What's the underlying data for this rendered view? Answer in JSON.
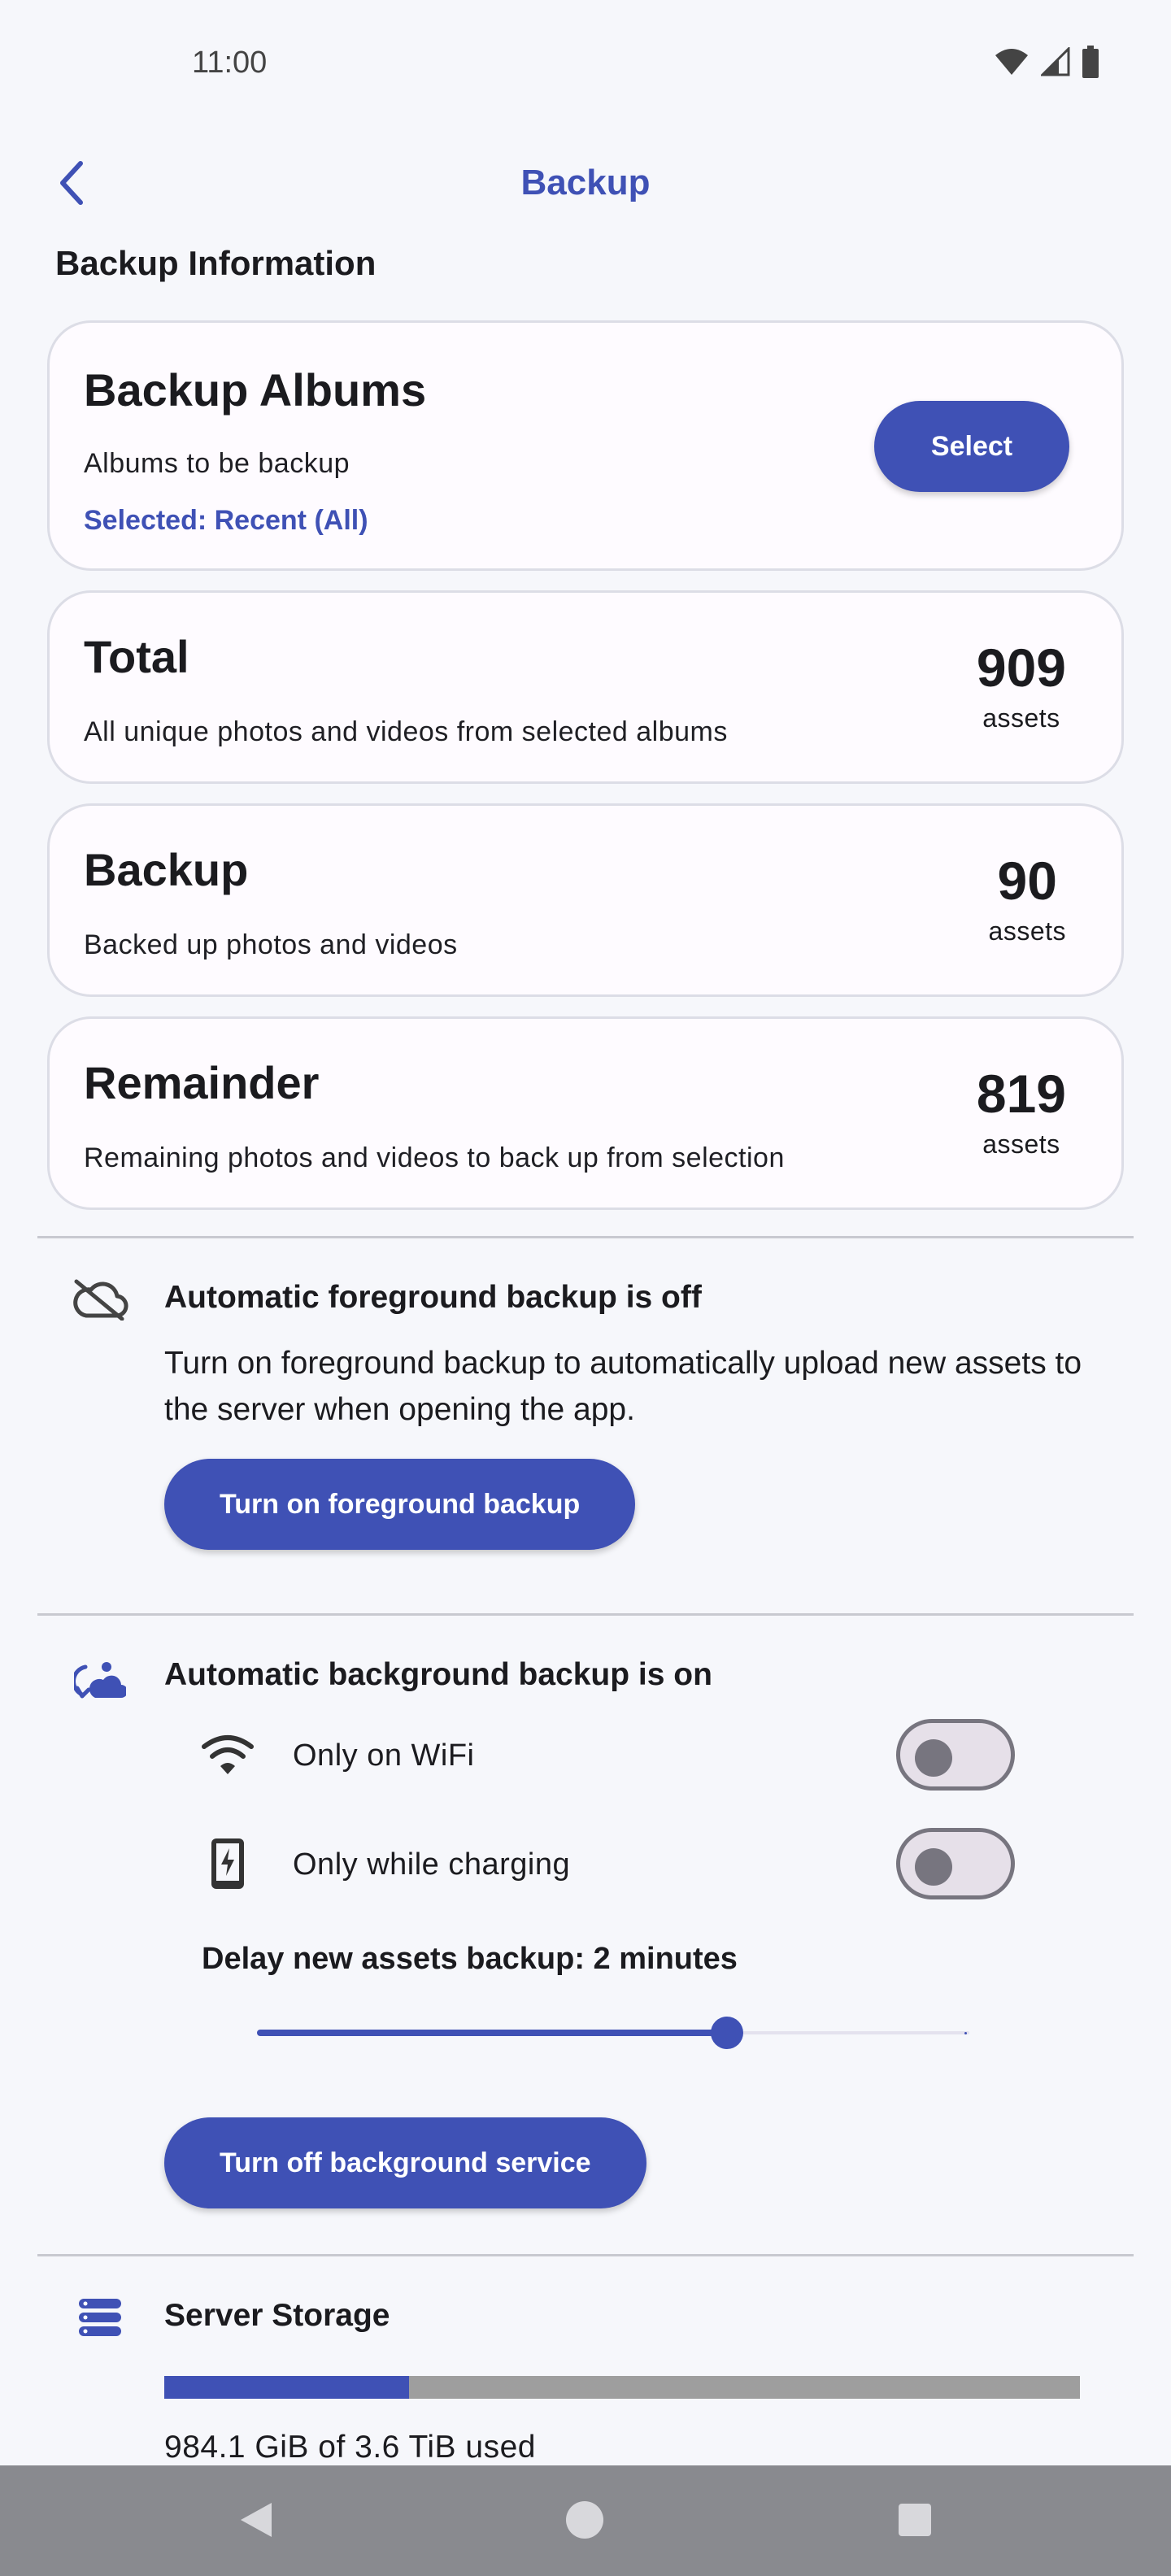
{
  "status_bar": {
    "time": "11:00",
    "icons": [
      "wifi-icon",
      "signal-icon",
      "battery-icon"
    ]
  },
  "app_bar": {
    "title": "Backup",
    "back_icon": "chevron-left-icon"
  },
  "section_heading": "Backup Information",
  "albums_card": {
    "title": "Backup Albums",
    "subtitle": "Albums to be backup",
    "selected": "Selected: Recent (All)",
    "button_label": "Select"
  },
  "stats": [
    {
      "title": "Total",
      "subtitle": "All unique photos and videos from selected albums",
      "count": "909",
      "unit": "assets"
    },
    {
      "title": "Backup",
      "subtitle": "Backed up photos and videos",
      "count": "90",
      "unit": "assets"
    },
    {
      "title": "Remainder",
      "subtitle": "Remaining photos and videos to back up from selection",
      "count": "819",
      "unit": "assets"
    }
  ],
  "foreground": {
    "icon": "cloud-off-icon",
    "title": "Automatic foreground backup is off",
    "description": "Turn on foreground backup to automatically upload new assets to the server when opening the app.",
    "button_label": "Turn on foreground backup"
  },
  "background": {
    "icon": "cloud-sync-icon",
    "title": "Automatic background backup is on",
    "settings": [
      {
        "icon": "wifi-icon",
        "label": "Only on WiFi",
        "enabled": false
      },
      {
        "icon": "battery-charging-icon",
        "label": "Only while charging",
        "enabled": false
      }
    ],
    "delay_label": "Delay new assets backup: 2 minutes",
    "slider_fraction": 0.66,
    "button_label": "Turn off background service"
  },
  "storage": {
    "icon": "storage-icon",
    "title": "Server Storage",
    "used_fraction": 0.267,
    "usage_text": "984.1 GiB of 3.6 TiB used"
  },
  "colors": {
    "accent": "#3f51b5",
    "background": "#f6f7fb",
    "card": "#fefbff"
  },
  "nav_bar": {
    "icons": [
      "back-triangle-icon",
      "home-circle-icon",
      "recents-square-icon"
    ]
  }
}
